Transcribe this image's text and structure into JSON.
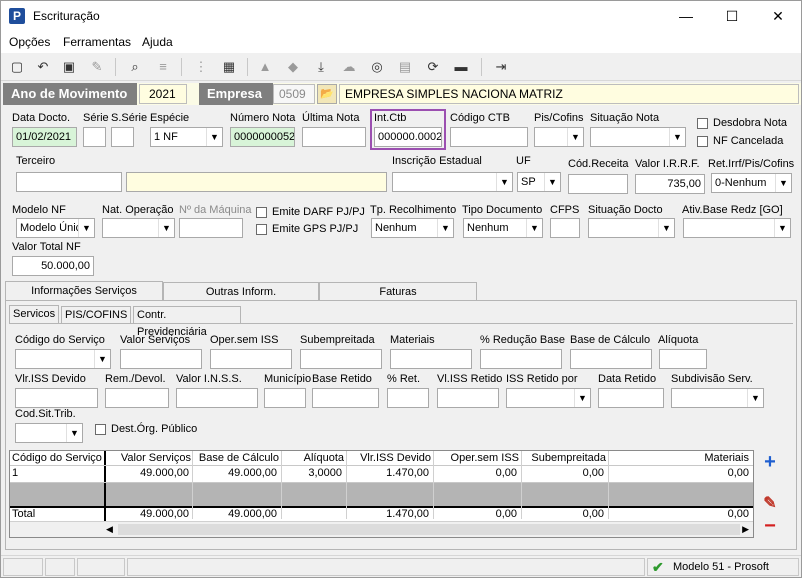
{
  "window": {
    "title": "Escrituração",
    "minimize": "—",
    "maximize": "☐",
    "close": "✕"
  },
  "menu": [
    "Opções",
    "Ferramentas",
    "Ajuda"
  ],
  "strip": {
    "ano_label": "Ano de Movimento",
    "ano_value": "2021",
    "empresa_label": "Empresa",
    "empresa_code": "0509",
    "empresa_name": "EMPRESA SIMPLES NACIONA MATRIZ"
  },
  "fields": {
    "data_docto_label": "Data Docto.",
    "data_docto": "01/02/2021",
    "serie_label": "Série",
    "subserie_label": "S.Série",
    "especie_label": "Espécie",
    "especie": "1 NF",
    "numero_nota_label": "Número Nota",
    "numero_nota": "0000000052",
    "ultima_nota_label": "Última Nota",
    "int_ctb_label": "Int.Ctb",
    "int_ctb": "000000.0002",
    "codigo_ctb_label": "Código CTB",
    "pis_cofins_label": "Pis/Cofins",
    "situacao_nota_label": "Situação Nota",
    "desdobra_nota": "Desdobra Nota",
    "nf_cancelada": "NF Cancelada",
    "terceiro_label": "Terceiro",
    "inscricao_label": "Inscrição Estadual",
    "uf_label": "UF",
    "uf": "SP",
    "cod_receita_label": "Cód.Receita",
    "valor_irrf_label": "Valor I.R.R.F.",
    "valor_irrf": "735,00",
    "ret_irrf_label": "Ret.Irrf/Pis/Cofins",
    "ret_irrf": "0-Nenhum",
    "modelo_nf_label": "Modelo NF",
    "modelo_nf": "Modelo Únic",
    "nat_operacao_label": "Nat. Operação",
    "n_maquina_label": "Nº da Máquina",
    "emite_darf": "Emite DARF PJ/PJ",
    "emite_gps": "Emite GPS PJ/PJ",
    "tp_recolhimento_label": "Tp. Recolhimento",
    "tp_recolhimento": "Nenhum",
    "tipo_documento_label": "Tipo Documento",
    "tipo_documento": "Nenhum",
    "cfps_label": "CFPS",
    "situacao_docto_label": "Situação Docto",
    "ativ_base_label": "Ativ.Base Redz [GO]",
    "valor_total_nf_label": "Valor Total NF",
    "valor_total_nf": "50.000,00"
  },
  "tabs": [
    "Informações Serviços",
    "Outras Inform.",
    "Faturas"
  ],
  "subtabs": [
    "Servicos",
    "PIS/COFINS",
    "Contr. Previdenciária"
  ],
  "svc": {
    "codigo_servico": "Código do Serviço",
    "valor_servicos": "Valor Serviços",
    "oper_sem_iss": "Oper.sem ISS",
    "subempreitada": "Subempreitada",
    "materiais": "Materiais",
    "perc_reducao": "% Redução Base",
    "base_calculo": "Base de Cálculo",
    "aliquota": "Alíquota",
    "vlr_iss_devido": "Vlr.ISS Devido",
    "rem_devol": "Rem./Devol.",
    "valor_inss": "Valor I.N.S.S.",
    "municipio": "Município",
    "base_retido": "Base Retido",
    "perc_ret": "% Ret.",
    "vl_iss_retido": "Vl.ISS Retido",
    "iss_retido_por": "ISS Retido por",
    "data_retido": "Data Retido",
    "subdivisao": "Subdivisão Serv.",
    "cod_sit_trib": "Cod.Sit.Trib.",
    "dest_org_publico": "Dest.Órg. Público"
  },
  "grid": {
    "headers": [
      "Código do Serviço",
      "Valor Serviços",
      "Base de Cálculo",
      "Alíquota",
      "Vlr.ISS Devido",
      "Oper.sem ISS",
      "Subempreitada",
      "Materiais"
    ],
    "row": [
      "1",
      "49.000,00",
      "49.000,00",
      "3,0000",
      "1.470,00",
      "0,00",
      "0,00",
      "0,00"
    ],
    "total": [
      "Total",
      "49.000,00",
      "49.000,00",
      "",
      "1.470,00",
      "0,00",
      "0,00",
      "0,00"
    ]
  },
  "status": {
    "model": "Modelo 51 - Prosoft"
  },
  "colors": {
    "purple_highlight": "#9b4fb0",
    "add_blue": "#1f5fd0",
    "remove_red": "#d42020"
  }
}
